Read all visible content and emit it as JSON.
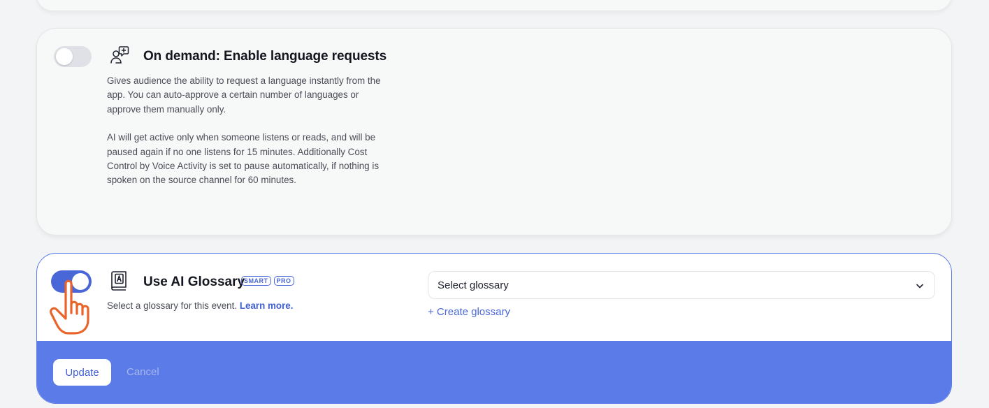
{
  "on_demand": {
    "title": "On demand: Enable language requests",
    "enabled": false,
    "desc_p1": "Gives audience the ability to request a language instantly from the app. You can auto-approve a certain number of languages or approve them manually only.",
    "desc_p2": "AI will get active only when someone listens or reads, and will be paused again if no one listens for 15 minutes. Additionally Cost Control by Voice Activity is set to pause automatically, if nothing is spoken on the source channel for 60 minutes."
  },
  "glossary": {
    "title": "Use AI Glossary",
    "enabled": true,
    "badges": [
      "SMART",
      "PRO"
    ],
    "desc": "Select a glossary for this event.",
    "learn_more": "Learn more.",
    "select_value": "Select glossary",
    "create_link": "+ Create glossary"
  },
  "footer": {
    "update_label": "Update",
    "cancel_label": "Cancel"
  },
  "colors": {
    "accent": "#4a67d8",
    "footer_bg": "#5b7be8",
    "hand_cursor": "#e8642a"
  },
  "icons": [
    "person-plus-icon",
    "book-icon",
    "chevron-down-icon",
    "hand-pointer-cursor"
  ]
}
